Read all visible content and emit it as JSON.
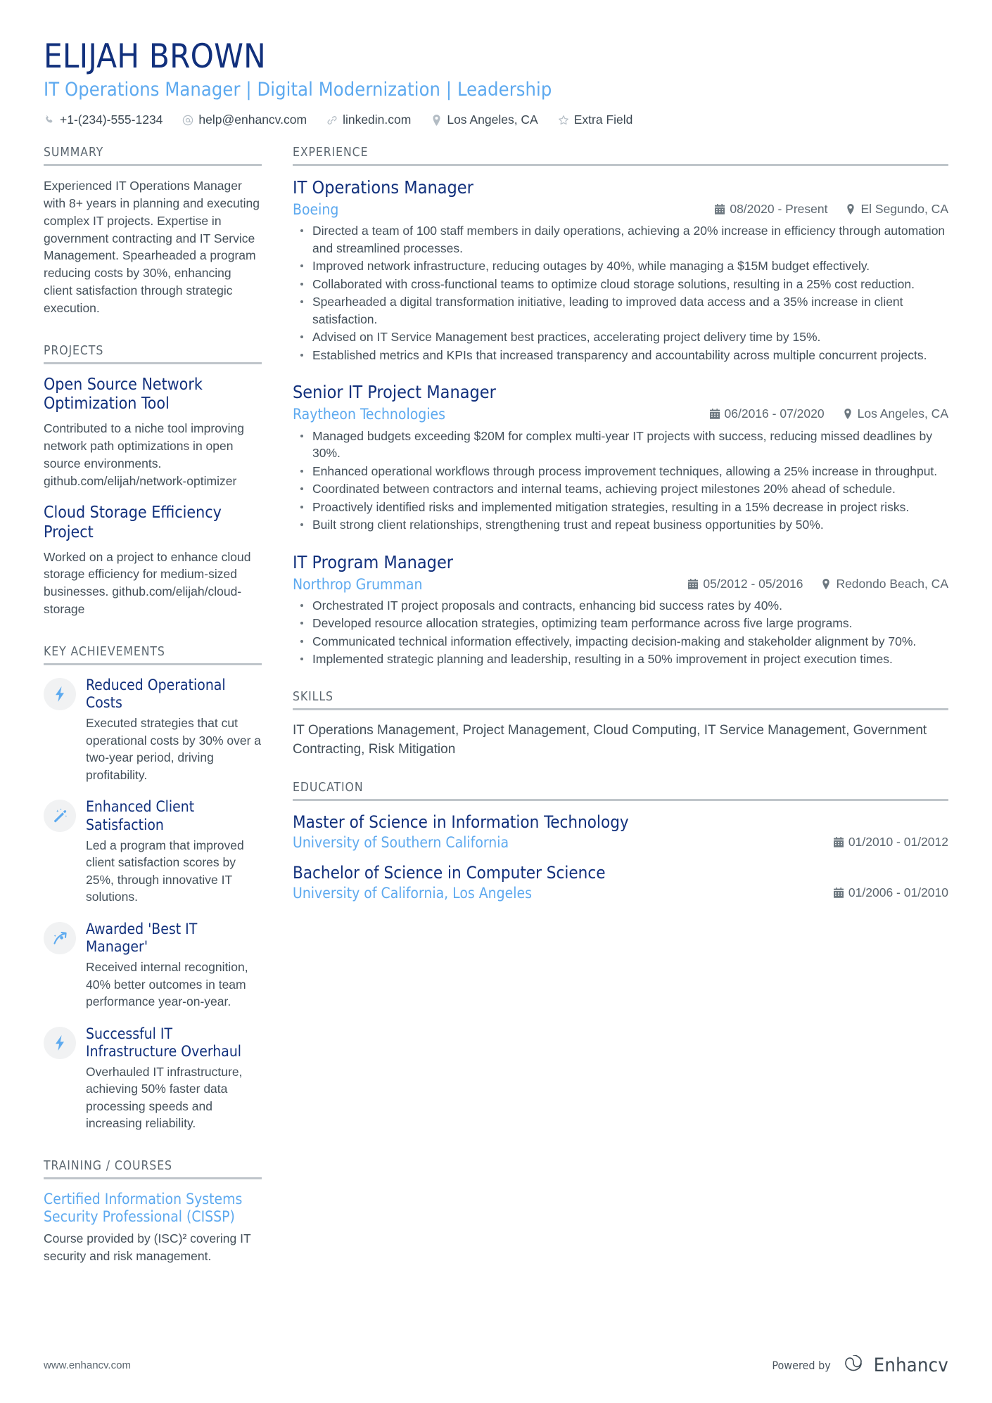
{
  "header": {
    "name": "ELIJAH BROWN",
    "headline": "IT Operations Manager | Digital Modernization | Leadership",
    "contacts": [
      {
        "icon": "phone-icon",
        "text": "+1-(234)-555-1234"
      },
      {
        "icon": "email-icon",
        "text": "help@enhancv.com"
      },
      {
        "icon": "link-icon",
        "text": "linkedin.com"
      },
      {
        "icon": "location-icon",
        "text": "Los Angeles, CA"
      },
      {
        "icon": "star-icon",
        "text": "Extra Field"
      }
    ]
  },
  "summary": {
    "heading": "SUMMARY",
    "text": "Experienced IT Operations Manager with 8+ years in planning and executing complex IT projects. Expertise in government contracting and IT Service Management. Spearheaded a program reducing costs by 30%, enhancing client satisfaction through strategic execution."
  },
  "projects": {
    "heading": "PROJECTS",
    "items": [
      {
        "name": "Open Source Network Optimization Tool",
        "description": "Contributed to a niche tool improving network path optimizations in open source environments. github.com/elijah/network-optimizer"
      },
      {
        "name": "Cloud Storage Efficiency Project",
        "description": "Worked on a project to enhance cloud storage efficiency for medium-sized businesses. github.com/elijah/cloud-storage"
      }
    ]
  },
  "achievements": {
    "heading": "KEY ACHIEVEMENTS",
    "items": [
      {
        "icon": "lightning-bolt-icon",
        "title": "Reduced Operational Costs",
        "description": "Executed strategies that cut operational costs by 30% over a two-year period, driving profitability."
      },
      {
        "icon": "magic-wand-icon",
        "title": "Enhanced Client Satisfaction",
        "description": "Led a program that improved client satisfaction scores by 25%, through innovative IT solutions."
      },
      {
        "icon": "growth-arrow-icon",
        "title": "Awarded 'Best IT Manager'",
        "description": "Received internal recognition, 40% better outcomes in team performance year-on-year."
      },
      {
        "icon": "lightning-bolt-icon",
        "title": "Successful IT Infrastructure Overhaul",
        "description": "Overhauled IT infrastructure, achieving 50% faster data processing speeds and increasing reliability."
      }
    ]
  },
  "training": {
    "heading": "TRAINING / COURSES",
    "items": [
      {
        "name": "Certified Information Systems Security Professional (CISSP)",
        "description": "Course provided by (ISC)² covering IT security and risk management."
      }
    ]
  },
  "experience": {
    "heading": "EXPERIENCE",
    "items": [
      {
        "title": "IT Operations Manager",
        "company": "Boeing",
        "dates": "08/2020 - Present",
        "location": "El Segundo, CA",
        "bullets": [
          "Directed a team of 100 staff members in daily operations, achieving a 20% increase in efficiency through automation and streamlined processes.",
          "Improved network infrastructure, reducing outages by 40%, while managing a $15M budget effectively.",
          "Collaborated with cross-functional teams to optimize cloud storage solutions, resulting in a 25% cost reduction.",
          "Spearheaded a digital transformation initiative, leading to improved data access and a 35% increase in client satisfaction.",
          "Advised on IT Service Management best practices, accelerating project delivery time by 15%.",
          "Established metrics and KPIs that increased transparency and accountability across multiple concurrent projects."
        ]
      },
      {
        "title": "Senior IT Project Manager",
        "company": "Raytheon Technologies",
        "dates": "06/2016 - 07/2020",
        "location": "Los Angeles, CA",
        "bullets": [
          "Managed budgets exceeding $20M for complex multi-year IT projects with success, reducing missed deadlines by 30%.",
          "Enhanced operational workflows through process improvement techniques, allowing a 25% increase in throughput.",
          "Coordinated between contractors and internal teams, achieving project milestones 20% ahead of schedule.",
          "Proactively identified risks and implemented mitigation strategies, resulting in a 15% decrease in project risks.",
          "Built strong client relationships, strengthening trust and repeat business opportunities by 50%."
        ]
      },
      {
        "title": "IT Program Manager",
        "company": "Northrop Grumman",
        "dates": "05/2012 - 05/2016",
        "location": "Redondo Beach, CA",
        "bullets": [
          "Orchestrated IT project proposals and contracts, enhancing bid success rates by 40%.",
          "Developed resource allocation strategies, optimizing team performance across five large programs.",
          "Communicated technical information effectively, impacting decision-making and stakeholder alignment by 70%.",
          "Implemented strategic planning and leadership, resulting in a 50% improvement in project execution times."
        ]
      }
    ]
  },
  "skills": {
    "heading": "SKILLS",
    "text": "IT Operations Management, Project Management, Cloud Computing, IT Service Management, Government Contracting, Risk Mitigation"
  },
  "education": {
    "heading": "EDUCATION",
    "items": [
      {
        "degree": "Master of Science in Information Technology",
        "school": "University of Southern California",
        "dates": "01/2010 - 01/2012"
      },
      {
        "degree": "Bachelor of Science in Computer Science",
        "school": "University of California, Los Angeles",
        "dates": "01/2006 - 01/2010"
      }
    ]
  },
  "footer": {
    "website": "www.enhancv.com",
    "powered_by": "Powered by",
    "brand": "Enhancv"
  }
}
